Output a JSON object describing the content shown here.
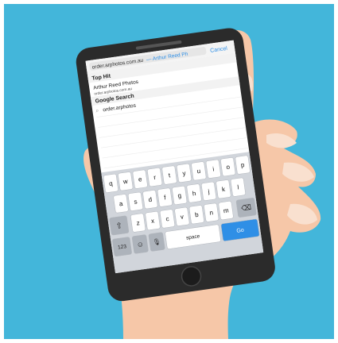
{
  "browser": {
    "address_text": "order.arphotos.com.au",
    "address_suggestion": "— Arthur Reed Ph",
    "cancel_label": "Cancel"
  },
  "results": {
    "top_hit_header": "Top Hit",
    "top_hit_title": "Arthur Reed Photos",
    "top_hit_url": "order.arphotos.com.au",
    "google_header": "Google Search",
    "google_query": "order.arphotos"
  },
  "keyboard": {
    "row1": [
      "q",
      "w",
      "e",
      "r",
      "t",
      "y",
      "u",
      "i",
      "o",
      "p"
    ],
    "row2": [
      "a",
      "s",
      "d",
      "f",
      "g",
      "h",
      "j",
      "k",
      "l"
    ],
    "row3": [
      "z",
      "x",
      "c",
      "v",
      "b",
      "n",
      "m"
    ],
    "numbers_label": "123",
    "space_label": "space",
    "go_label": "Go"
  },
  "colors": {
    "background": "#43b6da",
    "accent": "#2f8fe6",
    "skin": "#f6c7a8",
    "phone_body": "#2b2b2b"
  }
}
